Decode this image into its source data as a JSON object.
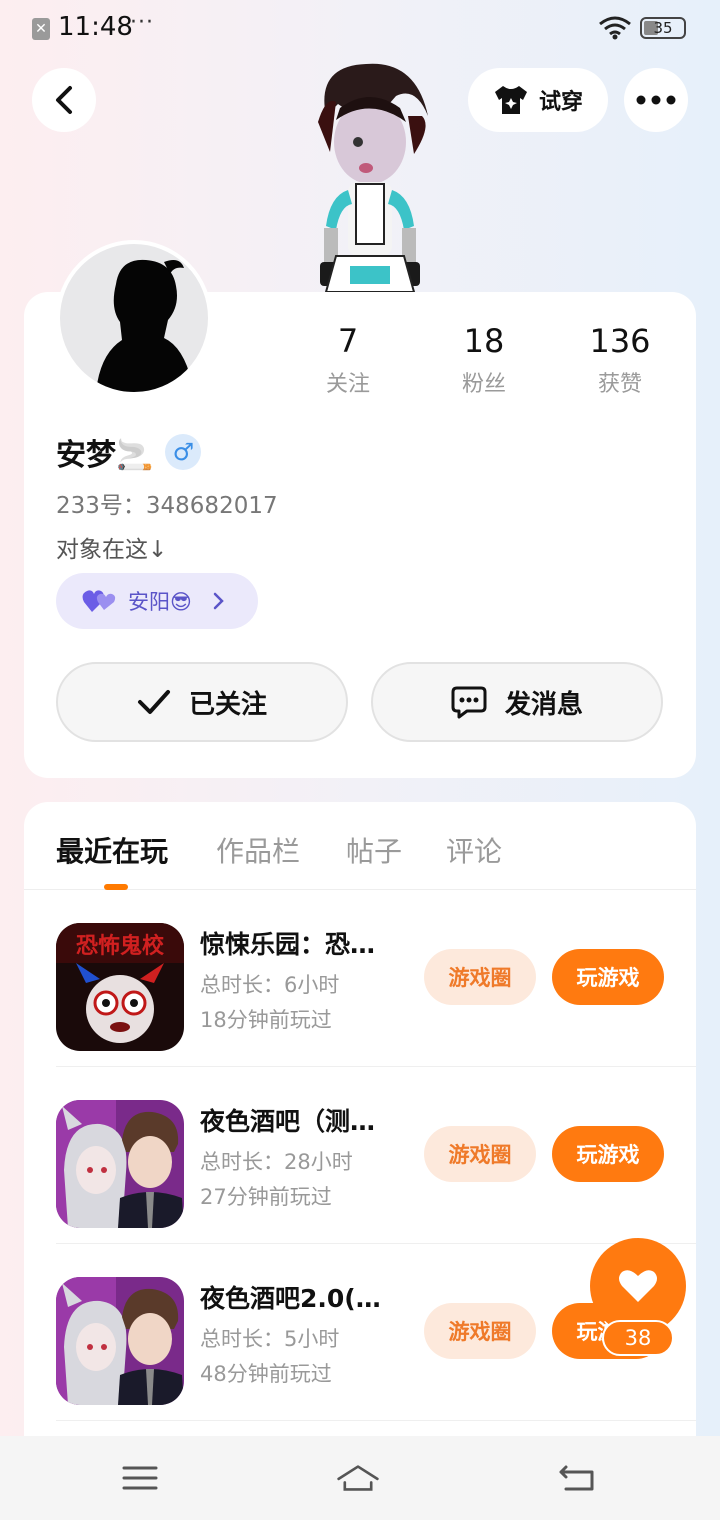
{
  "status_bar": {
    "time": "11:48",
    "dots": "···",
    "battery": "35"
  },
  "header": {
    "tryon_label": "试穿"
  },
  "profile": {
    "stats": [
      {
        "value": "7",
        "label": "关注"
      },
      {
        "value": "18",
        "label": "粉丝"
      },
      {
        "value": "136",
        "label": "获赞"
      }
    ],
    "username": "安梦🚬",
    "gender": "♂",
    "uid": "233号：348682017",
    "bio": "对象在这↓",
    "partner": "安阳😎",
    "follow_label": "已关注",
    "message_label": "发消息"
  },
  "tabs": [
    "最近在玩",
    "作品栏",
    "帖子",
    "评论"
  ],
  "active_tab": "最近在玩",
  "games": [
    {
      "title": "惊悚乐园：恐…",
      "duration": "总时长：6小时",
      "last_played": "18分钟前玩过",
      "icon_text": "恐怖鬼校",
      "circle_label": "游戏圈",
      "play_label": "玩游戏"
    },
    {
      "title": "夜色酒吧（测…",
      "duration": "总时长：28小时",
      "last_played": "27分钟前玩过",
      "circle_label": "游戏圈",
      "play_label": "玩游戏"
    },
    {
      "title": "夜色酒吧2.0(…",
      "duration": "总时长：5小时",
      "last_played": "48分钟前玩过",
      "circle_label": "游戏圈",
      "play_label": "玩游戏"
    }
  ],
  "like": {
    "count": "38"
  },
  "colors": {
    "accent": "#ff7a10",
    "accent_soft": "#fde9dc",
    "partner_bg": "#ebe9fb",
    "partner_text": "#5a54c8"
  }
}
